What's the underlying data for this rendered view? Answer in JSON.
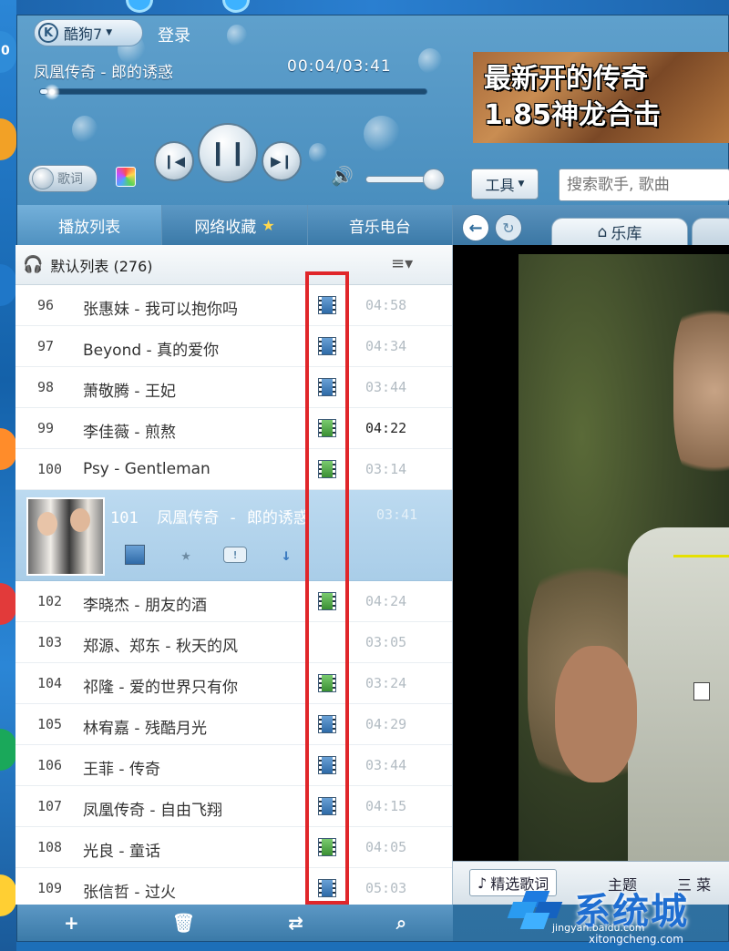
{
  "app": {
    "name": "酷狗7",
    "login_label": "登录"
  },
  "now_playing": {
    "title": "凤凰传奇 - 郎的诱惑",
    "time": "00:04/03:41",
    "progress_fraction": 0.018,
    "lyric_toggle_label": "歌词",
    "volume_fraction": 0.9
  },
  "ad": {
    "line1": "最新开的传奇",
    "line2": "1.85神龙合击"
  },
  "toolbar": {
    "tools_label": "工具",
    "search_placeholder": "搜索歌手, 歌曲"
  },
  "tabs": [
    {
      "label": "播放列表"
    },
    {
      "label": "网络收藏"
    },
    {
      "label": "音乐电台"
    }
  ],
  "browser": {
    "tab_label": "乐库"
  },
  "playlist": {
    "name": "默认列表 (276)",
    "rows_top": [
      {
        "num": "96",
        "title": "张惠妹 - 我可以抱你吗",
        "duration": "04:58",
        "mv": "blue"
      },
      {
        "num": "97",
        "title": "Beyond - 真的爱你",
        "duration": "04:34",
        "mv": "blue"
      },
      {
        "num": "98",
        "title": "萧敬腾 - 王妃",
        "duration": "03:44",
        "mv": "blue"
      },
      {
        "num": "99",
        "title": "李佳薇 - 煎熬",
        "duration": "04:22",
        "mv": "green"
      },
      {
        "num": "100",
        "title": "Psy - Gentleman",
        "duration": "03:14",
        "mv": "green"
      }
    ],
    "playing": {
      "num": "101",
      "title": "凤凰传奇 - 郎的诱惑",
      "duration": "03:41"
    },
    "rows_bottom": [
      {
        "num": "102",
        "title": "李晓杰 - 朋友的酒",
        "duration": "04:24",
        "mv": "green"
      },
      {
        "num": "103",
        "title": "郑源、郑东 - 秋天的风",
        "duration": "03:05",
        "mv": "none"
      },
      {
        "num": "104",
        "title": "祁隆 - 爱的世界只有你",
        "duration": "03:24",
        "mv": "green"
      },
      {
        "num": "105",
        "title": "林宥嘉 - 残酷月光",
        "duration": "04:29",
        "mv": "blue"
      },
      {
        "num": "106",
        "title": "王菲 - 传奇",
        "duration": "03:44",
        "mv": "blue"
      },
      {
        "num": "107",
        "title": "凤凰传奇 - 自由飞翔",
        "duration": "04:15",
        "mv": "blue"
      },
      {
        "num": "108",
        "title": "光良 - 童话",
        "duration": "04:05",
        "mv": "green"
      },
      {
        "num": "109",
        "title": "张信哲 - 过火",
        "duration": "05:03",
        "mv": "blue"
      }
    ]
  },
  "lyric_bar": {
    "tab1": "精选歌词",
    "tab2": "主题",
    "tab3": "三 菜"
  },
  "watermark": {
    "brand": "系统城",
    "url_small": "jingyan.baidu.com",
    "url": "xitongcheng.com"
  }
}
